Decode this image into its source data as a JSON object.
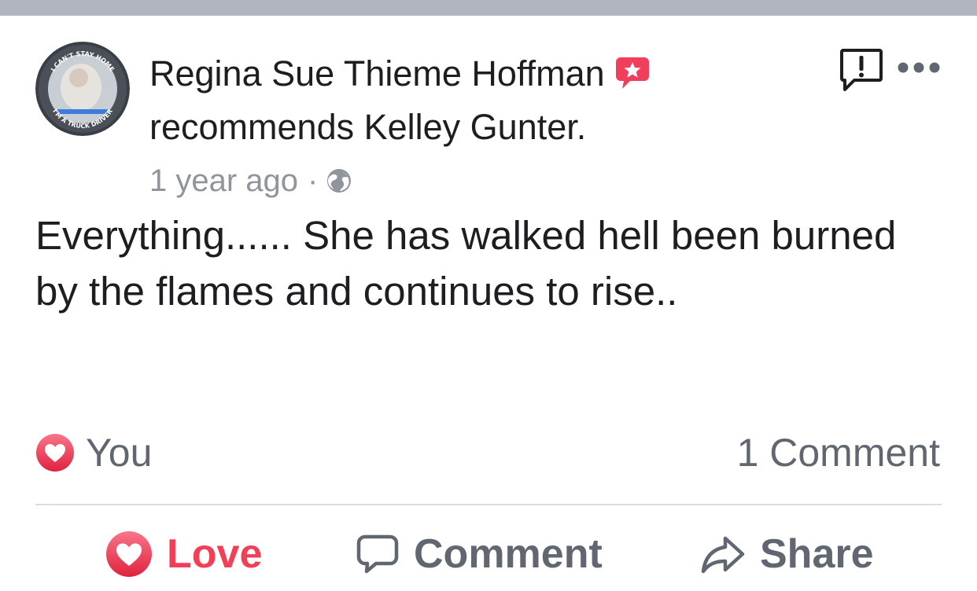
{
  "colors": {
    "top_strip": "#b1b5be",
    "love_accent": "#f33e58",
    "secondary_text": "#606770",
    "meta_text": "#90949c",
    "badge": "#f03e5c"
  },
  "post": {
    "author": "Regina Sue Thieme Hoffman",
    "action_text": "recommends Kelley Gunter.",
    "timestamp": "1 year ago",
    "meta_separator": "·",
    "privacy_icon": "globe-icon",
    "avatar_ring_top_text": "I CAN'T STAY HOME",
    "avatar_ring_bottom_text": "I'M A TRUCK DRIVER",
    "body": "Everything...... She has walked hell been burned by the flames and continues to rise.."
  },
  "reactions": {
    "icon": "love-reaction-icon",
    "who": "You"
  },
  "comments": {
    "count_label": "1 Comment"
  },
  "actions": {
    "love_label": "Love",
    "comment_label": "Comment",
    "share_label": "Share"
  }
}
